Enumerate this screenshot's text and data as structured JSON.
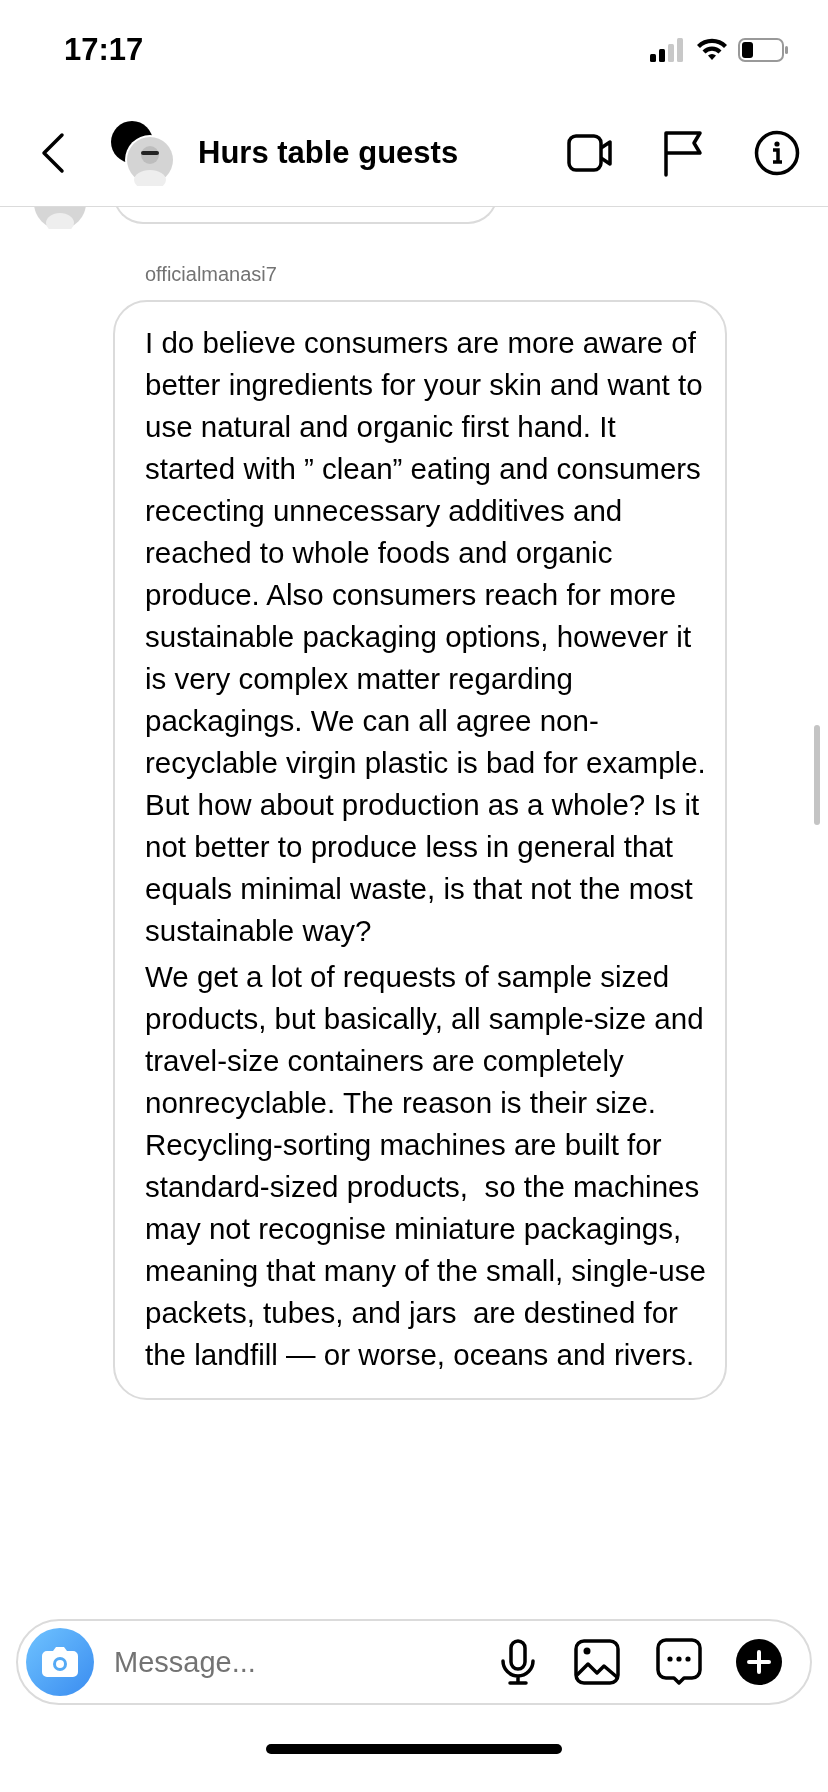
{
  "status_bar": {
    "time": "17:17"
  },
  "header": {
    "title": "Hurs table guests"
  },
  "messages": [
    {
      "sender": "officialmanasi7",
      "paragraphs": [
        "I do believe consumers are more aware of better ingredients for your skin and want to use natural and organic first hand. It started with ” clean” eating and consumers rececting unnecessary additives and reached to whole foods and organic produce. Also consumers reach for more sustainable packaging options, however it is very complex matter regarding packagings. We can all agree non-recyclable virgin plastic is bad for example. But how about production as a whole? Is it not better to produce less in general that equals minimal waste, is that not the most sustainable way?",
        "We get a lot of requests of sample sized products, but basically, all sample-size and travel-size containers are completely nonrecyclable. The reason is their size. Recycling-sorting machines are built for standard-sized products,  so the machines may not recognise miniature packagings, meaning that many of the small, single-use packets, tubes, and jars  are destined for the landfill — or worse, oceans and rivers."
      ]
    }
  ],
  "composer": {
    "placeholder": "Message..."
  }
}
